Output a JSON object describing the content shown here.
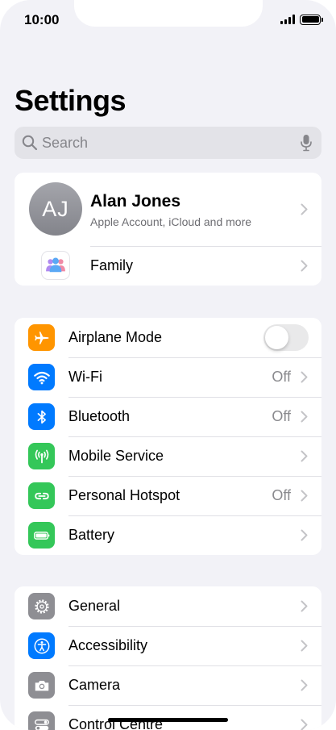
{
  "status": {
    "time": "10:00"
  },
  "header": {
    "title": "Settings"
  },
  "search": {
    "placeholder": "Search"
  },
  "profile": {
    "initials": "AJ",
    "name": "Alan Jones",
    "subtitle": "Apple Account, iCloud and more",
    "family_label": "Family"
  },
  "connectivity": [
    {
      "label": "Airplane Mode",
      "control": "toggle",
      "enabled": false,
      "icon": "airplane-icon",
      "color": "#ff9500"
    },
    {
      "label": "Wi-Fi",
      "value": "Off",
      "icon": "wifi-icon",
      "color": "#007aff"
    },
    {
      "label": "Bluetooth",
      "value": "Off",
      "icon": "bluetooth-icon",
      "color": "#007aff"
    },
    {
      "label": "Mobile Service",
      "value": "",
      "icon": "antenna-icon",
      "color": "#34c759"
    },
    {
      "label": "Personal Hotspot",
      "value": "Off",
      "icon": "hotspot-icon",
      "color": "#34c759"
    },
    {
      "label": "Battery",
      "value": "",
      "icon": "battery-icon",
      "color": "#34c759"
    }
  ],
  "system": [
    {
      "label": "General",
      "icon": "gear-icon",
      "color": "#8e8e93"
    },
    {
      "label": "Accessibility",
      "icon": "accessibility-icon",
      "color": "#007aff"
    },
    {
      "label": "Camera",
      "icon": "camera-icon",
      "color": "#8e8e93"
    },
    {
      "label": "Control Centre",
      "icon": "control-centre-icon",
      "color": "#8e8e93"
    }
  ]
}
